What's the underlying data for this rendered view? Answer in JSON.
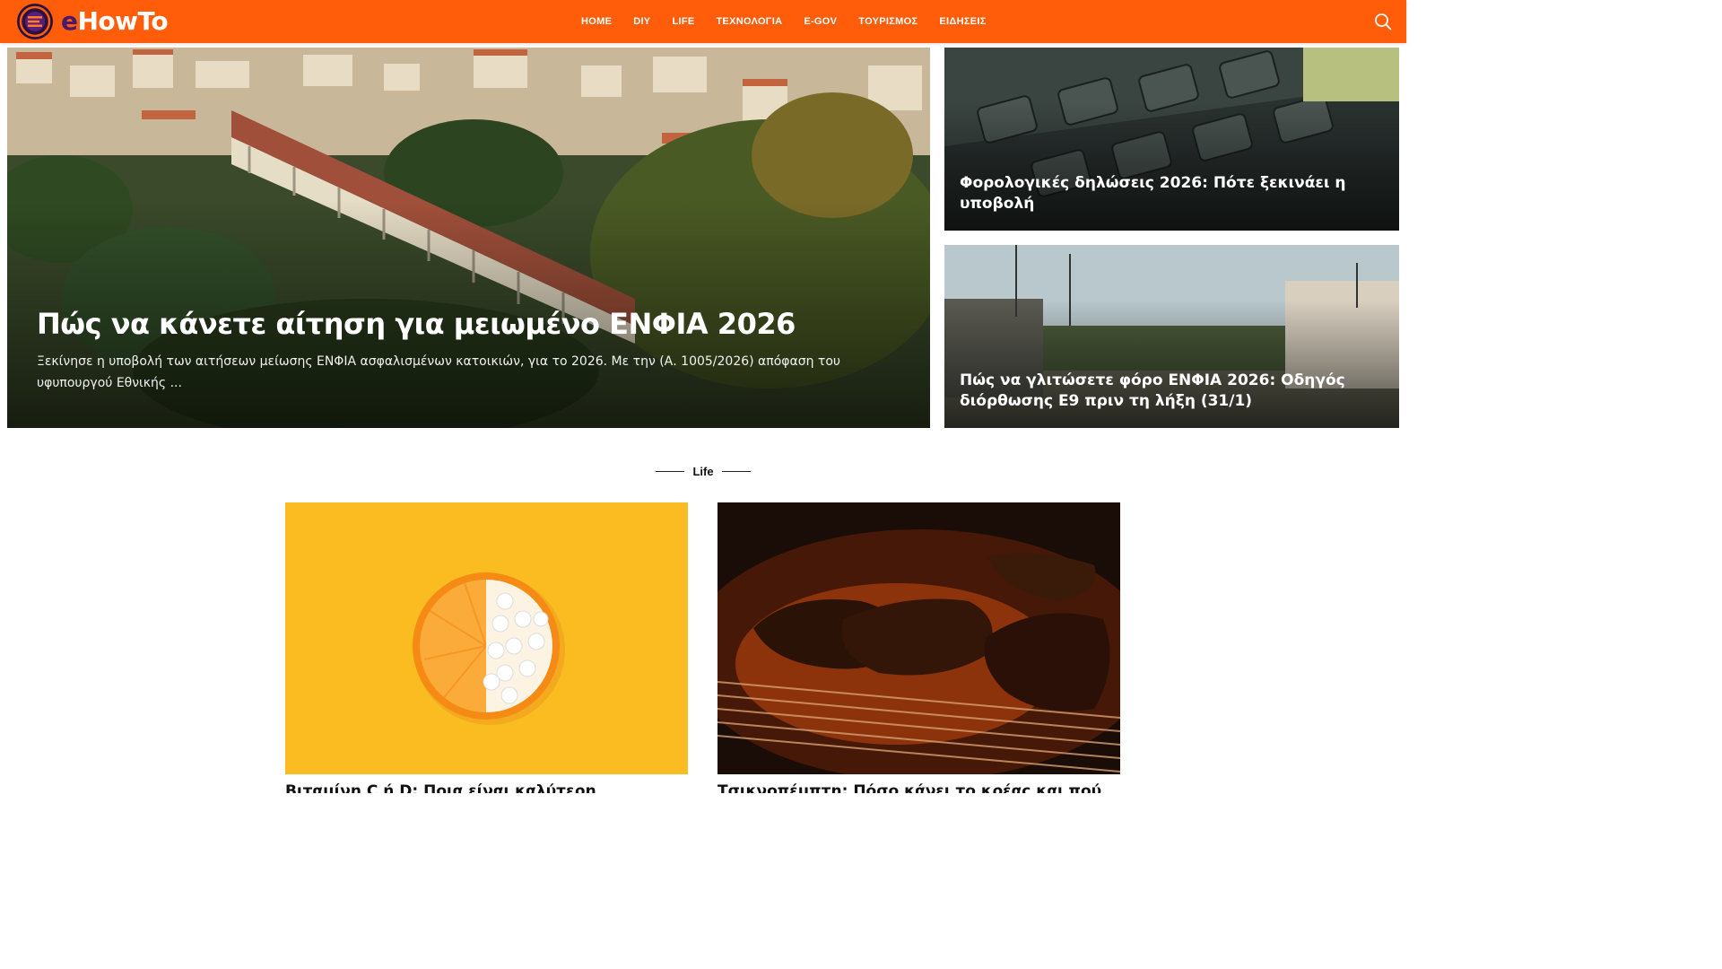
{
  "site": {
    "logo_text_e": "e",
    "logo_text_rest": "HowTo",
    "brand_color": "#ff5d0a",
    "logo_accent": "#4a1a6a"
  },
  "nav": {
    "items": [
      {
        "label": "HOME"
      },
      {
        "label": "DIY"
      },
      {
        "label": "LIFE"
      },
      {
        "label": "ΤΕΧΝΟΛΟΓΙΑ"
      },
      {
        "label": "E-GOV"
      },
      {
        "label": "ΤΟΥΡΙΣΜΟΣ"
      },
      {
        "label": "ΕΙΔΗΣΕΙΣ"
      }
    ],
    "search_icon": "search-icon"
  },
  "hero": {
    "main": {
      "title": "Πώς να κάνετε αίτηση για μειωμένο ΕΝΦΙΑ 2026",
      "excerpt": "Ξεκίνησε η υποβολή των αιτήσεων μείωσης ΕΝΦΙΑ ασφαλισμένων κατοικιών, για το 2026. Με την (Α. 1005/2026) απόφαση του υφυπουργού Εθνικής ..."
    },
    "side": [
      {
        "title": "Φορολογικές δηλώσεις 2026: Πότε ξεκινάει η υποβολή"
      },
      {
        "title": "Πώς να γλιτώσετε φόρο ΕΝΦΙΑ 2026: Οδηγός διόρθωσης Ε9 πριν τη λήξη (31/1)"
      }
    ]
  },
  "section": {
    "label": "Life",
    "cards": [
      {
        "title": "Βιταμίνη C ή D: Ποια είναι καλύτερη"
      },
      {
        "title": "Τσικνοπέμπτη: Πόσο κάνει το κρέας και πού θα"
      }
    ]
  }
}
